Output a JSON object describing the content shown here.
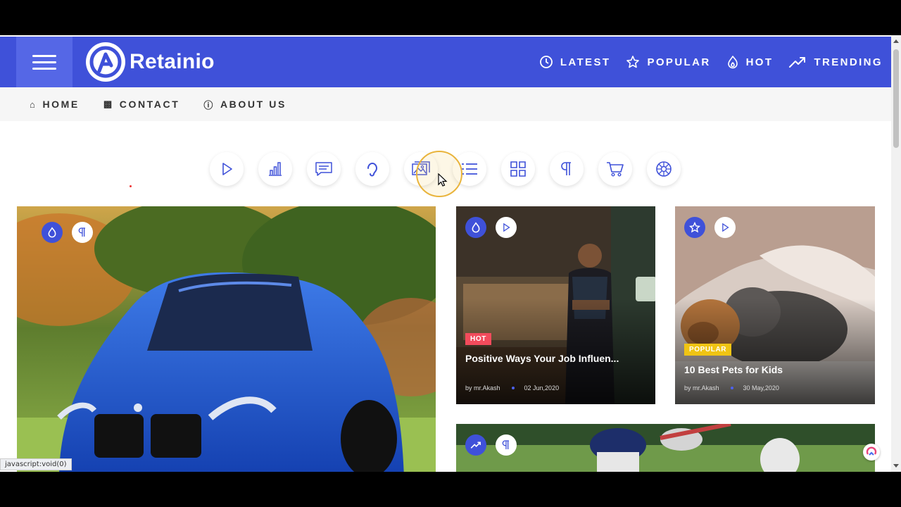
{
  "header": {
    "brand": "Retainio",
    "nav": [
      {
        "label": "LATEST",
        "icon": "clock-icon"
      },
      {
        "label": "POPULAR",
        "icon": "star-icon"
      },
      {
        "label": "HOT",
        "icon": "flame-icon"
      },
      {
        "label": "TRENDING",
        "icon": "trending-icon"
      }
    ],
    "accent": "#3f51d9"
  },
  "subnav": [
    {
      "label": "HOME",
      "icon": "home-icon"
    },
    {
      "label": "CONTACT",
      "icon": "contact-book-icon"
    },
    {
      "label": "ABOUT US",
      "icon": "info-icon"
    }
  ],
  "categories": [
    "play-icon",
    "bar-chart-icon",
    "chat-icon",
    "audio-icon",
    "image-icon",
    "list-icon",
    "grid-icon",
    "paragraph-icon",
    "cart-icon",
    "wheel-icon"
  ],
  "cards": {
    "main": {
      "icons": [
        "flame-icon",
        "paragraph-icon"
      ]
    },
    "a": {
      "tag": "HOT",
      "tag_color": "#f24b5c",
      "title": "Positive Ways Your Job Influen...",
      "author": "by mr.Akash",
      "date": "02 Jun,2020",
      "icons": [
        "flame-icon",
        "play-icon"
      ]
    },
    "b": {
      "tag": "POPULAR",
      "tag_color": "#f0c414",
      "title": "10 Best Pets for Kids",
      "author": "by mr.Akash",
      "date": "30 May,2020",
      "icons": [
        "star-icon",
        "play-icon"
      ]
    },
    "c": {
      "icons": [
        "trending-icon",
        "paragraph-icon"
      ]
    }
  },
  "status_bar": "javascript:void(0)"
}
